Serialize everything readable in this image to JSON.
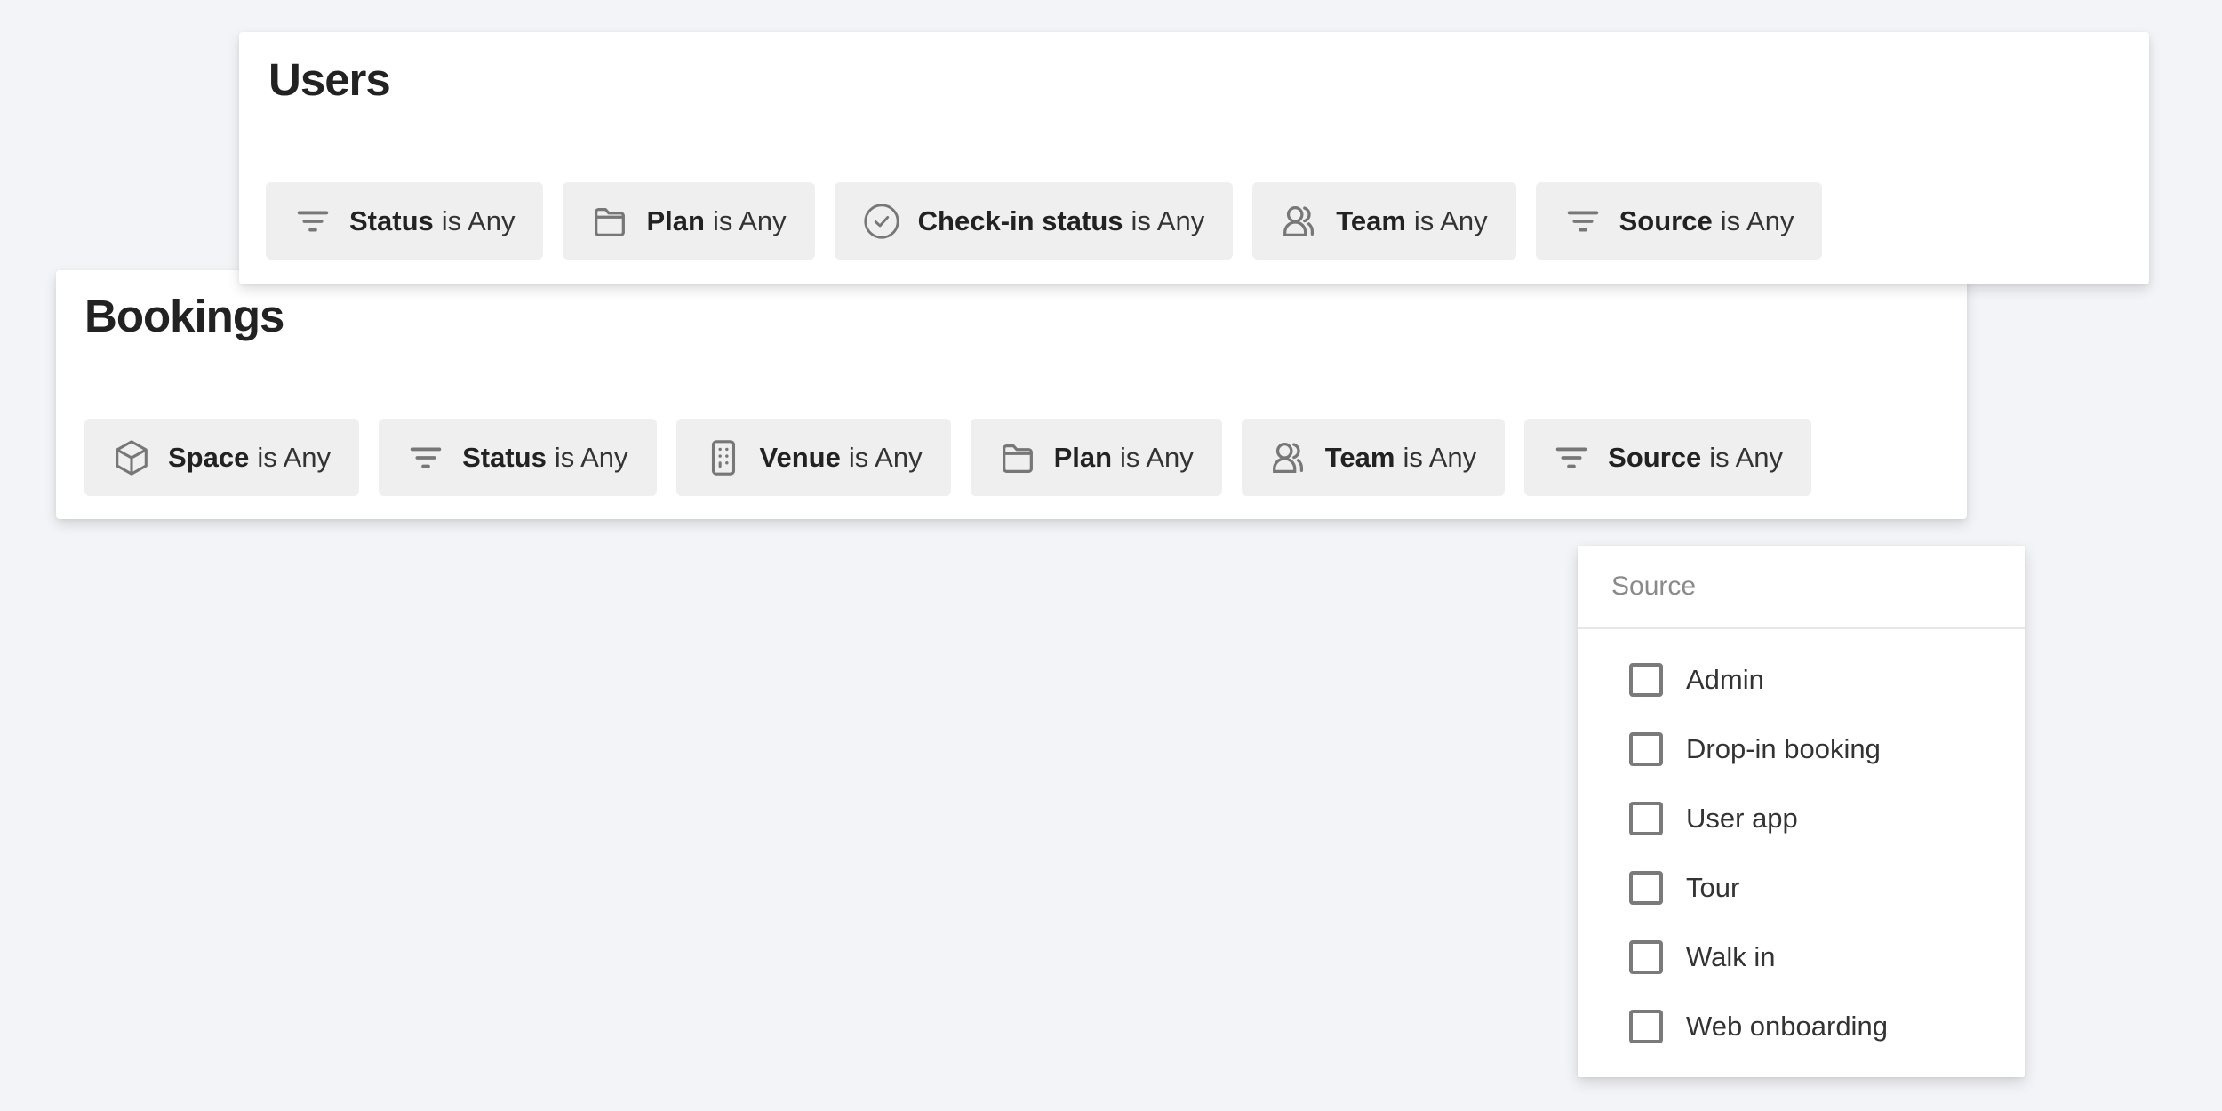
{
  "users": {
    "title": "Users",
    "filters": [
      {
        "icon": "filter-icon",
        "field": "Status",
        "operator": "is Any"
      },
      {
        "icon": "folder-icon",
        "field": "Plan",
        "operator": "is Any"
      },
      {
        "icon": "check-circle-icon",
        "field": "Check-in status",
        "operator": "is Any"
      },
      {
        "icon": "team-icon",
        "field": "Team",
        "operator": "is Any"
      },
      {
        "icon": "filter-icon",
        "field": "Source",
        "operator": "is Any"
      }
    ]
  },
  "bookings": {
    "title": "Bookings",
    "filters": [
      {
        "icon": "cube-icon",
        "field": "Space",
        "operator": "is Any"
      },
      {
        "icon": "filter-icon",
        "field": "Status",
        "operator": "is Any"
      },
      {
        "icon": "building-icon",
        "field": "Venue",
        "operator": "is Any"
      },
      {
        "icon": "folder-icon",
        "field": "Plan",
        "operator": "is Any"
      },
      {
        "icon": "team-icon",
        "field": "Team",
        "operator": "is Any"
      },
      {
        "icon": "filter-icon",
        "field": "Source",
        "operator": "is Any"
      }
    ]
  },
  "source_dropdown": {
    "search_placeholder": "Source",
    "search_value": "",
    "options": [
      {
        "label": "Admin",
        "checked": false
      },
      {
        "label": "Drop-in booking",
        "checked": false
      },
      {
        "label": "User app",
        "checked": false
      },
      {
        "label": "Tour",
        "checked": false
      },
      {
        "label": "Walk in",
        "checked": false
      },
      {
        "label": "Web onboarding",
        "checked": false
      }
    ]
  },
  "colors": {
    "background": "#f3f4f7",
    "card": "#ffffff",
    "chip": "#efefef",
    "icon": "#757575",
    "text": "#222222",
    "placeholder": "#8a8a8a"
  }
}
